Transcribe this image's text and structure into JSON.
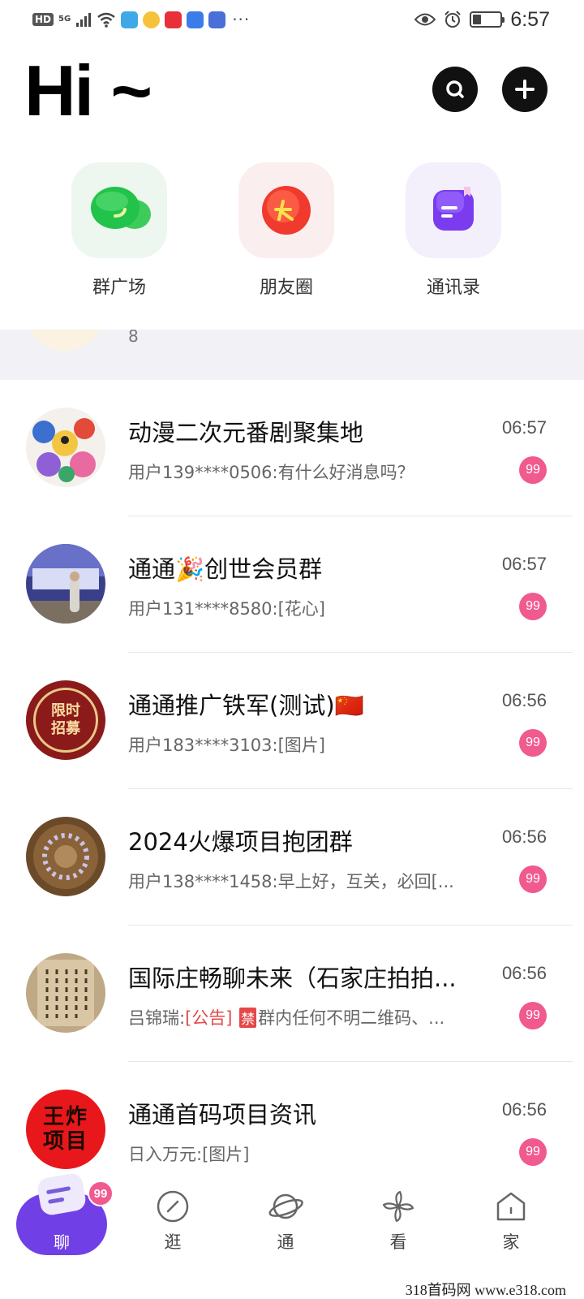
{
  "status_bar": {
    "network": "5G",
    "hd": "HD",
    "more": "···",
    "time": "6:57",
    "battery_level": 0.3
  },
  "header": {
    "greeting": "Hi ~"
  },
  "quick_entries": [
    {
      "label": "群广场",
      "icon": "green-chat-bubbles-icon"
    },
    {
      "label": "朋友圈",
      "icon": "red-circle-logo-icon"
    },
    {
      "label": "通讯录",
      "icon": "purple-contacts-icon"
    }
  ],
  "pinned": {
    "text": "8"
  },
  "chats": [
    {
      "title": "动漫二次元番剧聚集地",
      "time": "06:57",
      "preview": "用户139****0506:有什么好消息吗？",
      "badge": "99"
    },
    {
      "title": "通通🎉创世会员群",
      "time": "06:57",
      "preview": "用户131****8580:[花心]",
      "badge": "99"
    },
    {
      "title": "通通推广铁军(测试)🇨🇳",
      "time": "06:56",
      "preview": "用户183****3103:[图片]",
      "badge": "99"
    },
    {
      "title": "2024火爆项目抱团群",
      "time": "06:56",
      "preview": "用户138****1458:早上好，互关，必回[...",
      "badge": "99"
    },
    {
      "title": "国际庄畅聊未来（石家庄拍拍...",
      "time": "06:56",
      "preview_sender": "吕锦瑞:",
      "preview_notice": "[公告]",
      "preview_ban": "禁",
      "preview_rest": "群内任何不明二维码、...",
      "badge": "99"
    },
    {
      "title": "通通首码项目资讯",
      "time": "06:56",
      "preview": "日入万元:[图片]",
      "badge": "99"
    }
  ],
  "avatar_text": {
    "seal": [
      "限时",
      "招募"
    ],
    "red": [
      "王炸",
      "项目"
    ]
  },
  "bottom_nav": {
    "chat": {
      "label": "聊",
      "badge": "99"
    },
    "items": [
      {
        "label": "逛",
        "icon": "compass-icon"
      },
      {
        "label": "通",
        "icon": "planet-icon"
      },
      {
        "label": "看",
        "icon": "pinwheel-icon"
      },
      {
        "label": "家",
        "icon": "home-icon"
      }
    ]
  },
  "watermark": "318首码网 www.e318.com",
  "colors": {
    "badge": "#f05a8e",
    "accent_purple": "#7040e6",
    "notice_red": "#e54848"
  }
}
